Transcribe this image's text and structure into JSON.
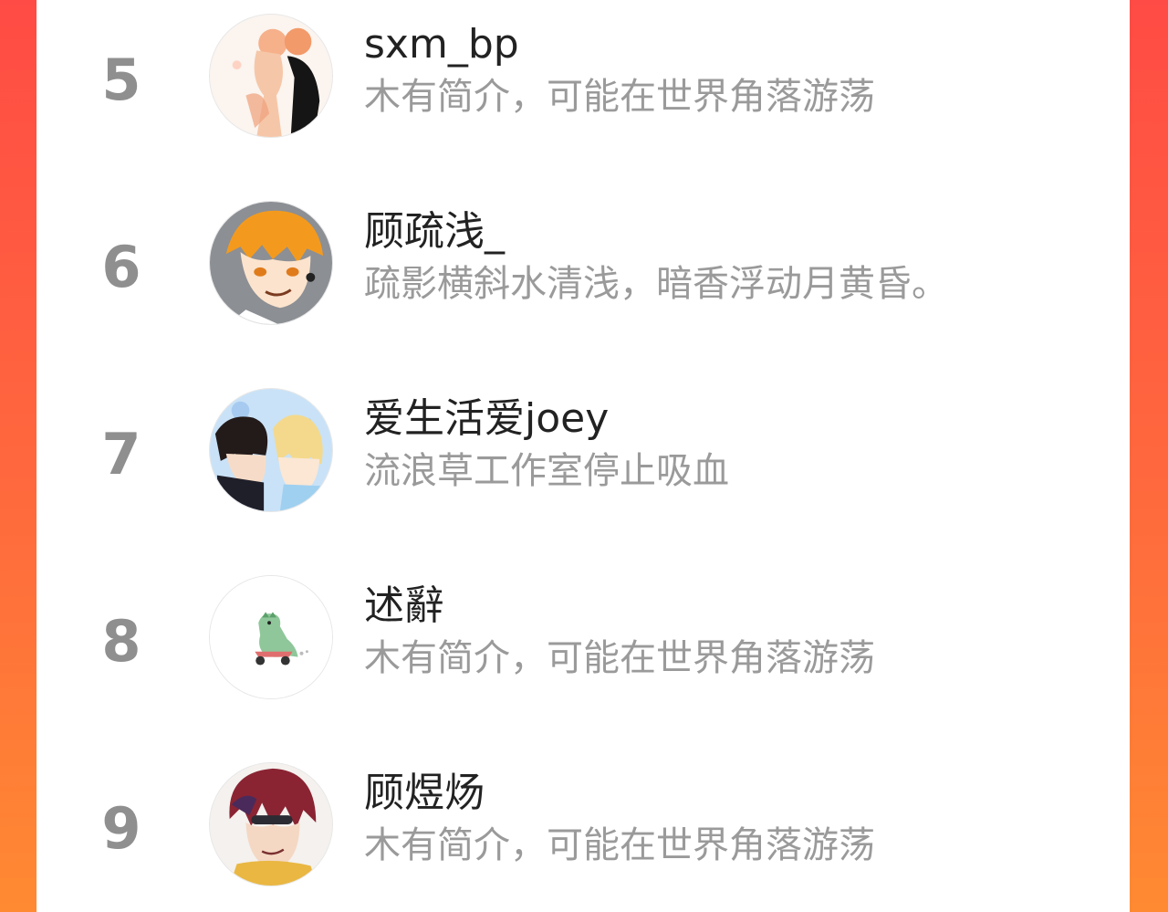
{
  "ranking": {
    "items": [
      {
        "rank": "5",
        "username": "sxm_bp",
        "bio": "木有简介，可能在世界角落游荡",
        "avatar_icon": "couple-anime-avatar"
      },
      {
        "rank": "6",
        "username": "顾疏浅_",
        "bio": "疏影横斜水清浅，暗香浮动月黄昏。",
        "avatar_icon": "orange-hair-anime-avatar"
      },
      {
        "rank": "7",
        "username": "爱生活爱joey",
        "bio": "流浪草工作室停止吸血",
        "avatar_icon": "two-chibi-anime-avatar"
      },
      {
        "rank": "8",
        "username": "述辭",
        "bio": "木有简介，可能在世界角落游荡",
        "avatar_icon": "green-dinosaur-avatar"
      },
      {
        "rank": "9",
        "username": "顾煜炀",
        "bio": "木有简介，可能在世界角落游荡",
        "avatar_icon": "red-hair-anime-avatar"
      }
    ]
  },
  "colors": {
    "background_start": "#ff4b45",
    "background_end": "#ff8a32",
    "rank_number": "#8f8f8f",
    "username": "#222222",
    "bio": "#9a9a9a"
  }
}
